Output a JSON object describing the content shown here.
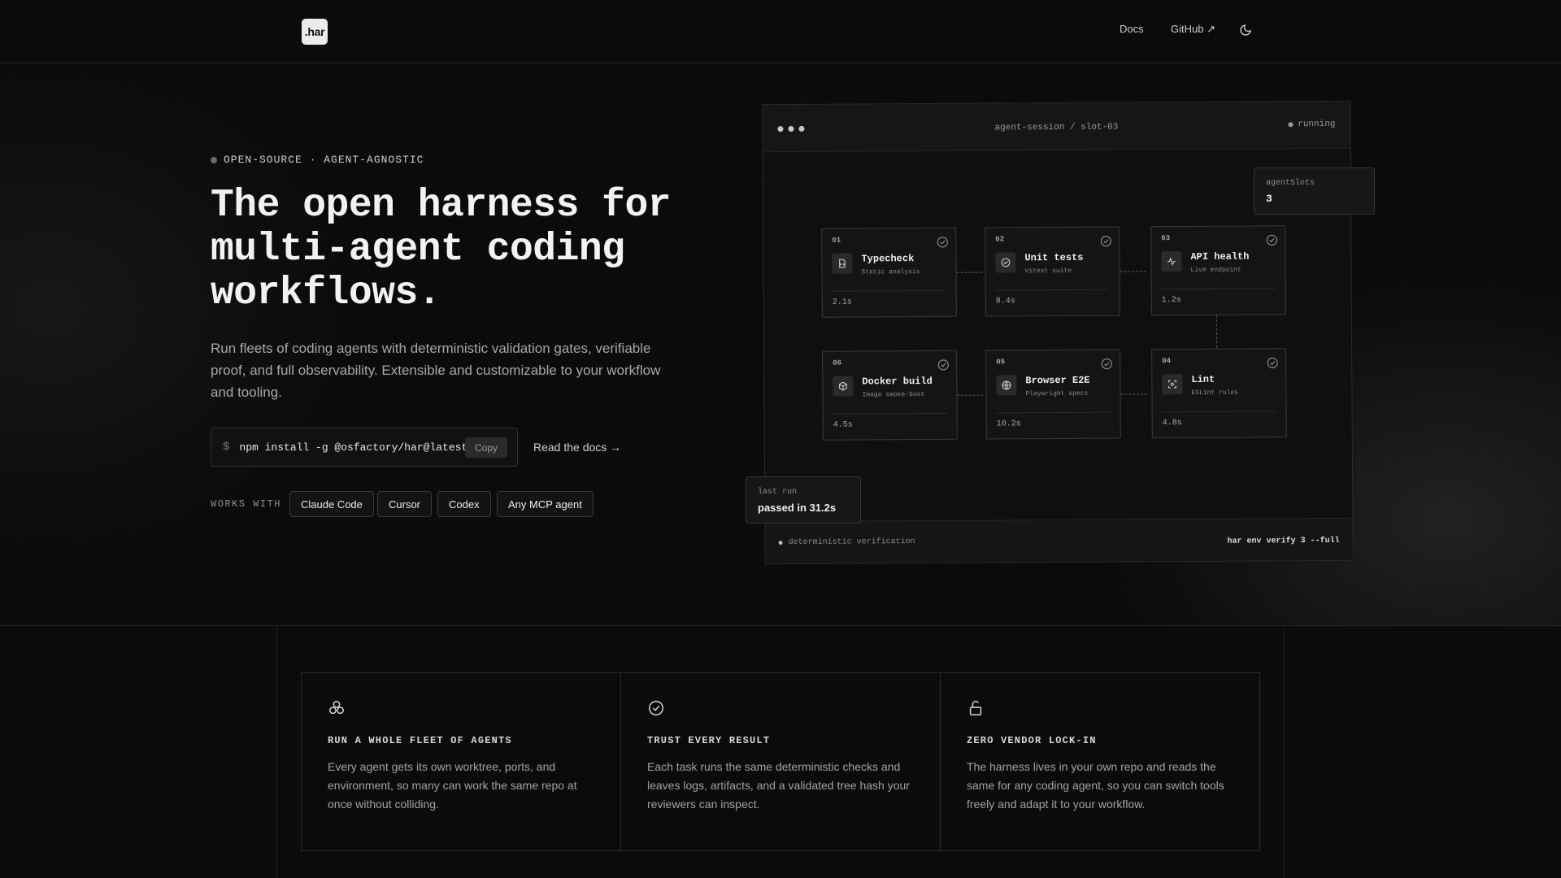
{
  "header": {
    "logo": ".har",
    "nav": {
      "docs": "Docs",
      "github": "GitHub ↗"
    },
    "theme_toggle_icon": "moon-icon"
  },
  "hero": {
    "eyebrow": "OPEN-SOURCE · AGENT-AGNOSTIC",
    "title": "The open harness for multi-agent coding workflows.",
    "subtitle": "Run fleets of coding agents with deterministic validation gates, verifiable proof, and full observability. Extensible and customizable to your workflow and tooling.",
    "install": {
      "prompt": "$",
      "command": "npm install -g @osfactory/har@latest",
      "copy_label": "Copy"
    },
    "read_docs": "Read the docs →",
    "works_with_label": "WORKS WITH",
    "works_with": [
      "Claude Code",
      "Cursor",
      "Codex",
      "Any MCP agent"
    ]
  },
  "session": {
    "title": "agent-session / slot-03",
    "status": "running",
    "tasks": [
      {
        "num": "01",
        "name": "Typecheck",
        "desc": "Static analysis",
        "time": "2.1s",
        "icon": "file-code-icon"
      },
      {
        "num": "02",
        "name": "Unit tests",
        "desc": "Vitest suite",
        "time": "8.4s",
        "icon": "check-circle-icon"
      },
      {
        "num": "03",
        "name": "API health",
        "desc": "Live endpoint",
        "time": "1.2s",
        "icon": "activity-icon"
      },
      {
        "num": "04",
        "name": "Lint",
        "desc": "ESLint rules",
        "time": "4.8s",
        "icon": "scan-icon"
      },
      {
        "num": "05",
        "name": "Browser E2E",
        "desc": "Playwright specs",
        "time": "10.2s",
        "icon": "globe-icon"
      },
      {
        "num": "06",
        "name": "Docker build",
        "desc": "Image smoke-boot",
        "time": "4.5s",
        "icon": "box-icon"
      }
    ],
    "agent_slots": {
      "label": "agentSlots",
      "value": "3"
    },
    "last_run": {
      "label": "last run",
      "value": "passed in 31.2s"
    },
    "footer_left": "deterministic verification",
    "footer_right": "har env verify 3 --full"
  },
  "features": [
    {
      "icon": "fleet-icon",
      "title": "RUN A WHOLE FLEET OF AGENTS",
      "body": "Every agent gets its own worktree, ports, and environment, so many can work the same repo at once without colliding."
    },
    {
      "icon": "check-circle-icon",
      "title": "TRUST EVERY RESULT",
      "body": "Each task runs the same deterministic checks and leaves logs, artifacts, and a validated tree hash your reviewers can inspect."
    },
    {
      "icon": "unlock-icon",
      "title": "ZERO VENDOR LOCK-IN",
      "body": "The harness lives in your own repo and reads the same for any coding agent, so you can switch tools freely and adapt it to your workflow."
    }
  ]
}
